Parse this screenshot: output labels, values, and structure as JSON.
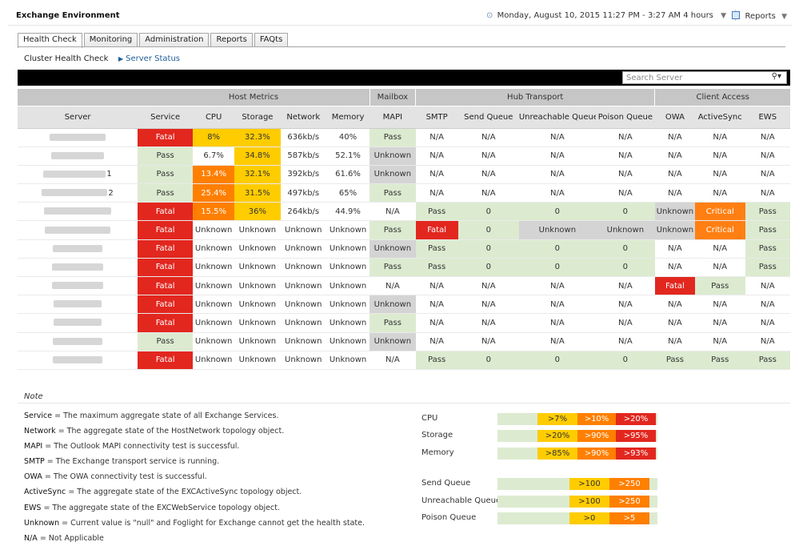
{
  "header": {
    "title": "Exchange Environment",
    "date_range": "Monday, August 10, 2015 11:27 PM - 3:27 AM 4 hours",
    "reports_label": "Reports"
  },
  "tabs": [
    {
      "label": "Health Check",
      "active": true
    },
    {
      "label": "Monitoring",
      "active": false
    },
    {
      "label": "Administration",
      "active": false
    },
    {
      "label": "Reports",
      "active": false
    },
    {
      "label": "FAQts",
      "active": false
    }
  ],
  "subnav": {
    "current": "Cluster Health Check",
    "link": "Server Status"
  },
  "search": {
    "placeholder": "Search Server"
  },
  "groups": [
    "Host Metrics",
    "Mailbox",
    "Hub Transport",
    "Client Access"
  ],
  "columns": [
    "Server",
    "Service",
    "CPU",
    "Storage",
    "Network",
    "Memory",
    "MAPI",
    "SMTP",
    "Send Queue",
    "Unreachable Queue",
    "Poison Queue",
    "OWA",
    "ActiveSync",
    "EWS"
  ],
  "rows": [
    {
      "suffix": "",
      "cells": [
        "Fatal",
        "8%",
        "32.3%",
        "636kb/s",
        "40%",
        "Pass",
        "N/A",
        "N/A",
        "N/A",
        "N/A",
        "N/A",
        "N/A",
        "N/A"
      ]
    },
    {
      "suffix": "",
      "cells": [
        "Pass",
        "6.7%",
        "34.8%",
        "587kb/s",
        "52.1%",
        "Unknown",
        "N/A",
        "N/A",
        "N/A",
        "N/A",
        "N/A",
        "N/A",
        "N/A"
      ]
    },
    {
      "suffix": "1",
      "cells": [
        "Pass",
        "13.4%",
        "32.1%",
        "392kb/s",
        "61.6%",
        "Unknown",
        "N/A",
        "N/A",
        "N/A",
        "N/A",
        "N/A",
        "N/A",
        "N/A"
      ]
    },
    {
      "suffix": "2",
      "cells": [
        "Pass",
        "25.4%",
        "31.5%",
        "497kb/s",
        "65%",
        "Pass",
        "N/A",
        "N/A",
        "N/A",
        "N/A",
        "N/A",
        "N/A",
        "N/A"
      ]
    },
    {
      "suffix": "",
      "cells": [
        "Fatal",
        "15.5%",
        "36%",
        "264kb/s",
        "44.9%",
        "N/A",
        "Pass",
        "0",
        "0",
        "0",
        "Unknown",
        "Critical",
        "Pass"
      ]
    },
    {
      "suffix": "",
      "cells": [
        "Fatal",
        "Unknown",
        "Unknown",
        "Unknown",
        "Unknown",
        "Pass",
        "Fatal",
        "0",
        "Unknown",
        "Unknown",
        "Unknown",
        "Critical",
        "Pass"
      ]
    },
    {
      "suffix": "",
      "cells": [
        "Fatal",
        "Unknown",
        "Unknown",
        "Unknown",
        "Unknown",
        "Unknown",
        "Pass",
        "0",
        "0",
        "0",
        "N/A",
        "N/A",
        "Pass"
      ]
    },
    {
      "suffix": "",
      "cells": [
        "Fatal",
        "Unknown",
        "Unknown",
        "Unknown",
        "Unknown",
        "Pass",
        "Pass",
        "0",
        "0",
        "0",
        "N/A",
        "N/A",
        "Pass"
      ]
    },
    {
      "suffix": "",
      "cells": [
        "Fatal",
        "Unknown",
        "Unknown",
        "Unknown",
        "Unknown",
        "N/A",
        "N/A",
        "N/A",
        "N/A",
        "N/A",
        "Fatal",
        "Pass",
        "N/A"
      ]
    },
    {
      "suffix": "",
      "cells": [
        "Fatal",
        "Unknown",
        "Unknown",
        "Unknown",
        "Unknown",
        "Unknown",
        "N/A",
        "N/A",
        "N/A",
        "N/A",
        "N/A",
        "N/A",
        "N/A"
      ]
    },
    {
      "suffix": "",
      "cells": [
        "Fatal",
        "Unknown",
        "Unknown",
        "Unknown",
        "Unknown",
        "Pass",
        "N/A",
        "N/A",
        "N/A",
        "N/A",
        "N/A",
        "N/A",
        "N/A"
      ]
    },
    {
      "suffix": "",
      "cells": [
        "Pass",
        "Unknown",
        "Unknown",
        "Unknown",
        "Unknown",
        "Unknown",
        "N/A",
        "N/A",
        "N/A",
        "N/A",
        "N/A",
        "N/A",
        "N/A"
      ]
    },
    {
      "suffix": "",
      "cells": [
        "Fatal",
        "Unknown",
        "Unknown",
        "Unknown",
        "Unknown",
        "N/A",
        "Pass",
        "0",
        "0",
        "0",
        "Pass",
        "Pass",
        "Pass"
      ]
    }
  ],
  "note": {
    "title": "Note",
    "items": [
      {
        "term": "Service",
        "desc": " = The maximum aggregate state of all Exchange Services."
      },
      {
        "term": "Network",
        "desc": " = The aggregate state of the HostNetwork topology object."
      },
      {
        "term": "MAPI",
        "desc": " = The Outlook MAPI connectivity test is successful."
      },
      {
        "term": "SMTP",
        "desc": " = The Exchange transport service is running."
      },
      {
        "term": "OWA",
        "desc": " = The OWA connectivity test is successful."
      },
      {
        "term": "ActiveSync",
        "desc": " = The aggregate state of the EXCActiveSync topology object."
      },
      {
        "term": "EWS",
        "desc": " = The aggregate state of the EXCWebService topology object."
      },
      {
        "term": "Unknown",
        "desc": " = Current value is \"null\" and Foglight for Exchange cannot get the health state."
      },
      {
        "term": "N/A",
        "desc": " = Not Applicable"
      }
    ]
  },
  "legend": [
    {
      "label": "CPU",
      "thresholds": [
        ">7%",
        ">10%",
        ">20%"
      ]
    },
    {
      "label": "Storage",
      "thresholds": [
        ">20%",
        ">90%",
        ">95%"
      ]
    },
    {
      "label": "Memory",
      "thresholds": [
        ">85%",
        ">90%",
        ">93%"
      ]
    },
    {
      "label": "Send Queue",
      "thresholds": [
        ">100",
        ">250"
      ]
    },
    {
      "label": "Unreachable Queue",
      "thresholds": [
        ">100",
        ">250"
      ]
    },
    {
      "label": "Poison Queue",
      "thresholds": [
        ">0",
        ">5"
      ]
    }
  ],
  "colors": {
    "fatal": "#e2271f",
    "warning": "#ffcc00",
    "high": "#ff7f00",
    "pass": "#dcebd0",
    "unknown": "#d4d4d4"
  }
}
